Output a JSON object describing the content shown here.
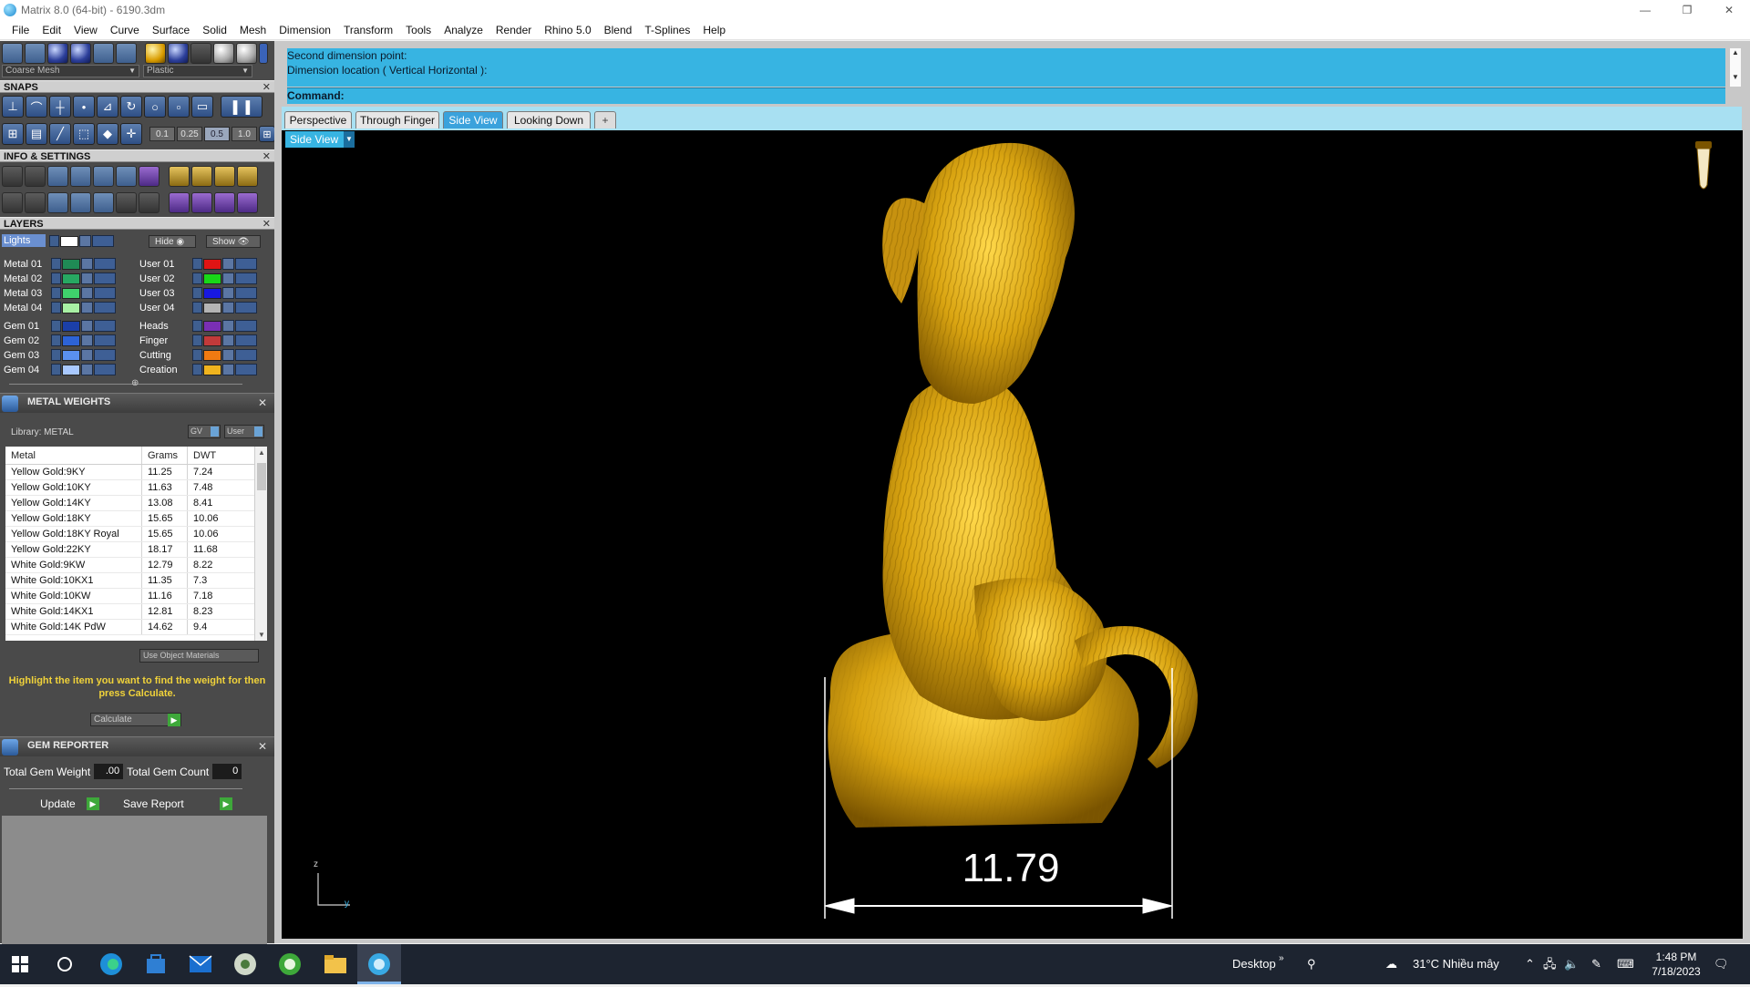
{
  "window": {
    "title": "Matrix 8.0 (64-bit) - 6190.3dm",
    "minimize": "—",
    "restore": "❐",
    "close": "✕"
  },
  "menu": [
    "File",
    "Edit",
    "View",
    "Curve",
    "Surface",
    "Solid",
    "Mesh",
    "Dimension",
    "Transform",
    "Tools",
    "Analyze",
    "Render",
    "Rhino 5.0",
    "Blend",
    "T-Splines",
    "Help"
  ],
  "toolbar": {
    "mesh_quality": "Coarse Mesh",
    "material": "Plastic"
  },
  "snaps": {
    "title": "SNAPS",
    "values": [
      "0.1",
      "0.25",
      "0.5",
      "1.0"
    ]
  },
  "info_settings": {
    "title": "INFO & SETTINGS"
  },
  "layers": {
    "title": "LAYERS",
    "lights_label": "Lights",
    "hide_label": "Hide",
    "show_label": "Show",
    "left": [
      {
        "name": "Metal 01",
        "color": "#1f8a55"
      },
      {
        "name": "Metal 02",
        "color": "#27a862"
      },
      {
        "name": "Metal 03",
        "color": "#3fd06c"
      },
      {
        "name": "Metal 04",
        "color": "#a8f0a4"
      },
      {
        "name": "Gem 01",
        "color": "#1b3fa8"
      },
      {
        "name": "Gem 02",
        "color": "#2d63d6"
      },
      {
        "name": "Gem 03",
        "color": "#5a90f0"
      },
      {
        "name": "Gem 04",
        "color": "#a8c8ff"
      }
    ],
    "right": [
      {
        "name": "User 01",
        "color": "#e01414"
      },
      {
        "name": "User 02",
        "color": "#18d818"
      },
      {
        "name": "User 03",
        "color": "#1818e0"
      },
      {
        "name": "User 04",
        "color": "#b4b4b4"
      },
      {
        "name": "Heads",
        "color": "#7a2fb4"
      },
      {
        "name": "Finger",
        "color": "#c23a3a"
      },
      {
        "name": "Cutting",
        "color": "#f07a12"
      },
      {
        "name": "Creation",
        "color": "#f0b41e"
      }
    ]
  },
  "metal_weights": {
    "title": "METAL WEIGHTS",
    "library": "Library: METAL",
    "btn_gv": "GV",
    "btn_user": "User",
    "columns": [
      "Metal",
      "Grams",
      "DWT"
    ],
    "rows": [
      [
        "Yellow Gold:9KY",
        "11.25",
        "7.24"
      ],
      [
        "Yellow Gold:10KY",
        "11.63",
        "7.48"
      ],
      [
        "Yellow Gold:14KY",
        "13.08",
        "8.41"
      ],
      [
        "Yellow Gold:18KY",
        "15.65",
        "10.06"
      ],
      [
        "Yellow Gold:18KY Royal",
        "15.65",
        "10.06"
      ],
      [
        "Yellow Gold:22KY",
        "18.17",
        "11.68"
      ],
      [
        "White Gold:9KW",
        "12.79",
        "8.22"
      ],
      [
        "White Gold:10KX1",
        "11.35",
        "7.3"
      ],
      [
        "White Gold:10KW",
        "11.16",
        "7.18"
      ],
      [
        "White Gold:14KX1",
        "12.81",
        "8.23"
      ],
      [
        "White Gold:14K PdW",
        "14.62",
        "9.4"
      ]
    ],
    "use_object_materials": "Use Object Materials",
    "hint": "Highlight the item you want to find the weight for then press Calculate.",
    "calculate": "Calculate"
  },
  "gem_reporter": {
    "title": "GEM REPORTER",
    "total_weight_label": "Total Gem Weight",
    "total_weight": ".00",
    "total_count_label": "Total Gem Count",
    "total_count": "0",
    "update": "Update",
    "save_report": "Save Report"
  },
  "command": {
    "history": [
      "Second dimension point:",
      "Dimension location ( Vertical  Horizontal ):"
    ],
    "prompt": "Command:"
  },
  "tabs": [
    "Perspective",
    "Through Finger",
    "Side View",
    "Looking Down",
    "+"
  ],
  "active_tab": "Side View",
  "viewport": {
    "label": "Side View",
    "dimension": "11.79",
    "axis_z": "z",
    "axis_y": "y"
  },
  "taskbar": {
    "desktop": "Desktop",
    "chevron": "»",
    "weather": "31°C  Nhiều mây",
    "time": "1:48 PM",
    "date": "7/18/2023"
  },
  "colors": {
    "command_bg": "#37b4e2",
    "gold": "#d4a017",
    "panel_bg": "#4a4a4a",
    "hint_yellow": "#f0d23a"
  }
}
